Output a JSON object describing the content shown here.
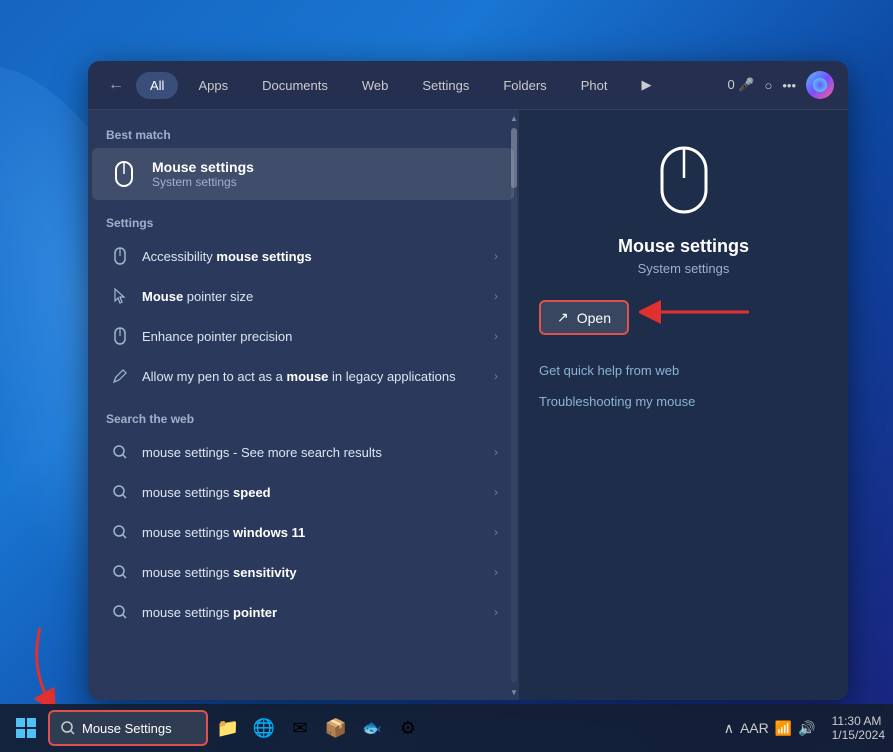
{
  "desktop": {
    "background": "Windows 11 blue swirl"
  },
  "search_nav": {
    "back_label": "←",
    "tabs": [
      {
        "label": "All",
        "active": true
      },
      {
        "label": "Apps"
      },
      {
        "label": "Documents"
      },
      {
        "label": "Web"
      },
      {
        "label": "Settings"
      },
      {
        "label": "Folders"
      },
      {
        "label": "Phot"
      },
      {
        "label": "▶"
      },
      {
        "label": "0"
      }
    ],
    "more_label": "•••"
  },
  "search_left": {
    "best_match_label": "Best match",
    "best_match_title": "Mouse settings",
    "best_match_subtitle": "System settings",
    "settings_label": "Settings",
    "settings_items": [
      {
        "text_before": "Accessibility ",
        "text_bold": "mouse settings",
        "icon": "mouse"
      },
      {
        "text_before": "",
        "text_bold": "Mouse",
        "text_after": " pointer size",
        "icon": "pointer"
      },
      {
        "text_before": "Enhance pointer precision",
        "text_bold": "",
        "icon": "mouse"
      },
      {
        "text_before": "Allow my pen to act as a ",
        "text_bold": "mouse",
        "text_after": " in legacy applications",
        "icon": "pen"
      }
    ],
    "web_label": "Search the web",
    "web_items": [
      {
        "text_before": "mouse settings",
        "text_bold": "- See more search results",
        "icon": "search"
      },
      {
        "text_before": "mouse settings ",
        "text_bold": "speed",
        "icon": "search"
      },
      {
        "text_before": "mouse settings ",
        "text_bold": "windows 11",
        "icon": "search"
      },
      {
        "text_before": "mouse settings ",
        "text_bold": "sensitivity",
        "icon": "search"
      },
      {
        "text_before": "mouse settings ",
        "text_bold": "pointer",
        "icon": "search"
      }
    ]
  },
  "search_right": {
    "title": "Mouse settings",
    "subtitle": "System settings",
    "open_label": "Open",
    "links": [
      "Get quick help from web",
      "Troubleshooting my mouse"
    ]
  },
  "taskbar": {
    "search_placeholder": "Mouse Settings",
    "icons": [
      "📁",
      "🌐",
      "✉",
      "📦",
      "🐟",
      "⚙"
    ]
  }
}
